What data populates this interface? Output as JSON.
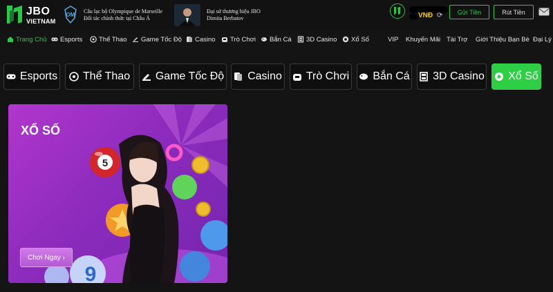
{
  "header": {
    "brand_top": "JBO",
    "brand_bottom": "VIETNAM",
    "partner1_line1": "Câu lạc bộ Olympique de Marseille",
    "partner1_line2": "Đối tác chính thức tại Châu Á",
    "partner2_line1": "Đại sứ thương hiệu JBO",
    "partner2_line2": "Dimita Berbatov",
    "balance_currency": "VNĐ",
    "deposit_label": "Gửi Tiền",
    "withdraw_label": "Rút Tiền"
  },
  "nav": {
    "items": [
      {
        "label": "Trang Chủ",
        "icon": "home-icon"
      },
      {
        "label": "Esports",
        "icon": "gamepad-icon"
      },
      {
        "label": "Thể Thao",
        "icon": "soccer-ball-icon"
      },
      {
        "label": "Game Tốc Độ",
        "icon": "speedometer-icon"
      },
      {
        "label": "Casino",
        "icon": "cards-icon"
      },
      {
        "label": "Trò Chơi",
        "icon": "slot-icon"
      },
      {
        "label": "Bắn Cá",
        "icon": "fish-icon"
      },
      {
        "label": "3D Casino",
        "icon": "3d-icon"
      },
      {
        "label": "Xổ Số",
        "icon": "lottery-icon"
      },
      {
        "label": "VIP"
      },
      {
        "label": "Khuyến Mãi"
      },
      {
        "label": "Tài Trợ"
      },
      {
        "label": "Giới Thiệu Bạn Bè"
      },
      {
        "label": "Đại Lý"
      }
    ]
  },
  "categories": [
    {
      "label": "Esports",
      "icon": "gamepad-icon"
    },
    {
      "label": "Thể Thao",
      "icon": "soccer-ball-icon"
    },
    {
      "label": "Game Tốc Độ",
      "icon": "speedometer-icon"
    },
    {
      "label": "Casino",
      "icon": "cards-icon"
    },
    {
      "label": "Trò Chơi",
      "icon": "slot-icon"
    },
    {
      "label": "Bắn Cá",
      "icon": "fish-icon"
    },
    {
      "label": "3D Casino",
      "icon": "3d-icon"
    },
    {
      "label": "Xổ Số",
      "icon": "lottery-icon"
    }
  ],
  "active_category": "Xổ Số",
  "game_card": {
    "title": "XỔ SỐ",
    "play_label": "Chơi Ngay ›",
    "ball_number": "5",
    "big_number": "9"
  },
  "colors": {
    "accent": "#2cc84a",
    "card_purple": "#9b2fc6",
    "gold": "#f3c72d"
  }
}
